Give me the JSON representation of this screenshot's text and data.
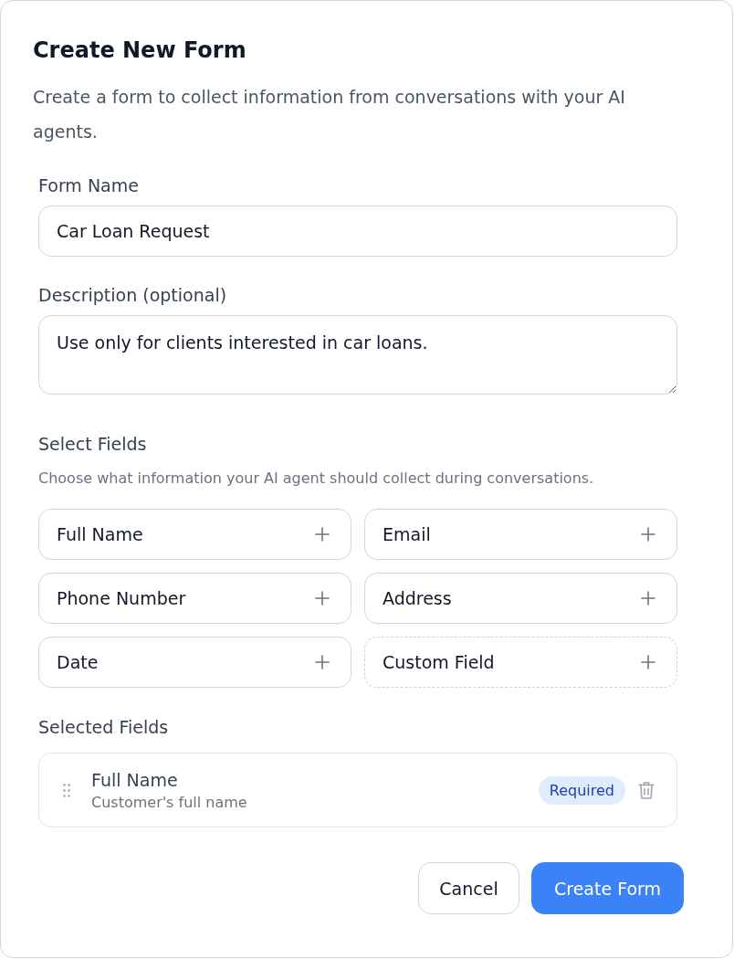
{
  "dialog": {
    "title": "Create New Form",
    "description": "Create a form to collect information from conversations with your AI agents."
  },
  "form_name": {
    "label": "Form Name",
    "value": "Car Loan Request"
  },
  "description_field": {
    "label": "Description (optional)",
    "value": "Use only for clients interested in car loans."
  },
  "select_fields": {
    "title": "Select Fields",
    "hint": "Choose what information your AI agent should collect during conversations.",
    "options": [
      {
        "label": "Full Name",
        "kind": "preset"
      },
      {
        "label": "Email",
        "kind": "preset"
      },
      {
        "label": "Phone Number",
        "kind": "preset"
      },
      {
        "label": "Address",
        "kind": "preset"
      },
      {
        "label": "Date",
        "kind": "preset"
      },
      {
        "label": "Custom Field",
        "kind": "custom"
      }
    ]
  },
  "selected_fields": {
    "title": "Selected Fields",
    "items": [
      {
        "name": "Full Name",
        "description": "Customer's full name",
        "badge": "Required"
      }
    ]
  },
  "buttons": [
    {
      "label": "Cancel",
      "kind": "secondary"
    },
    {
      "label": "Create Form",
      "kind": "primary"
    }
  ]
}
